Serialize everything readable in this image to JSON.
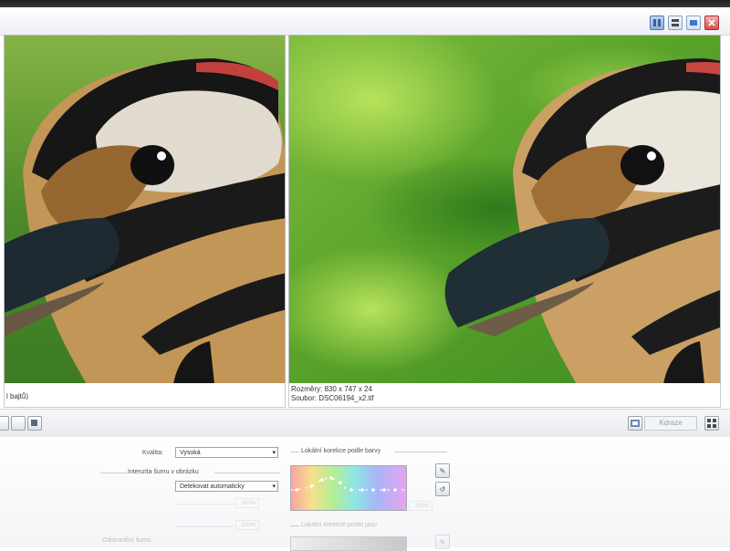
{
  "view_modes": [
    {
      "name": "side-by-side",
      "active": true
    },
    {
      "name": "split-vertical",
      "active": false
    },
    {
      "name": "single-view",
      "active": false
    },
    {
      "name": "close",
      "active": false
    }
  ],
  "left_pane": {
    "info_text": "l bajtů)"
  },
  "right_pane": {
    "dimensions": "Rozměry: 830 x 747 x 24",
    "file": "Soubor: DSC06194_x2.tif"
  },
  "toolbar": {
    "zoom_field_value": "Kdraze"
  },
  "settings": {
    "quality_label": "Kvalita:",
    "quality_value": "Vysoká",
    "noise_intensity_label": "Intenzita šumu v obrázku",
    "noise_detect_value": "Detekovat automaticky",
    "spin1_value": "100%",
    "spin2_value": "100%",
    "spin3_value": "100%",
    "noise_removal_label": "Odstranění šumu",
    "local_color_label": "Lokální korekce podle barvy",
    "local_brightness_label": "Lokální korekce podle jasu"
  },
  "colors": {
    "accent": "#4b77b3",
    "close": "#d84c4c"
  }
}
